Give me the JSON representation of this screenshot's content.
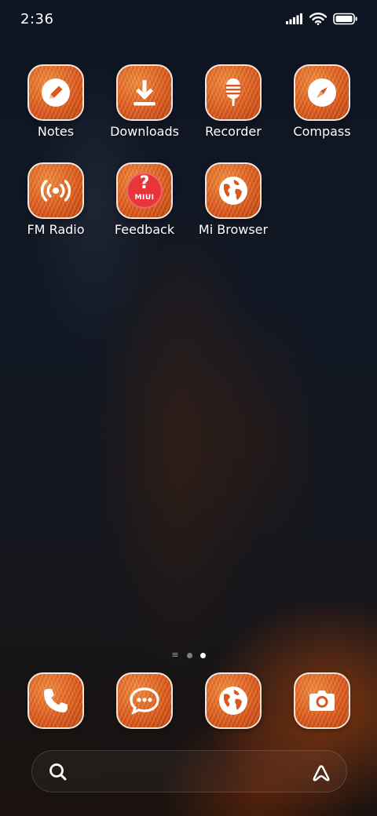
{
  "status_bar": {
    "time": "2:36",
    "icons": [
      "signal-icon",
      "wifi-icon",
      "battery-icon"
    ]
  },
  "home_apps": [
    {
      "label": "Notes",
      "icon": "pencil-icon"
    },
    {
      "label": "Downloads",
      "icon": "download-icon"
    },
    {
      "label": "Recorder",
      "icon": "microphone-icon"
    },
    {
      "label": "Compass",
      "icon": "compass-icon"
    },
    {
      "label": "FM Radio",
      "icon": "radio-icon"
    },
    {
      "label": "Feedback",
      "icon": "feedback-icon",
      "badge_text": "MIUI",
      "symbol": "?"
    },
    {
      "label": "Mi Browser",
      "icon": "globe-icon"
    }
  ],
  "page_indicator": {
    "pages": 2,
    "active_page": 2,
    "has_menu": true
  },
  "dock": [
    {
      "icon": "phone-icon"
    },
    {
      "icon": "message-icon"
    },
    {
      "icon": "globe-icon"
    },
    {
      "icon": "camera-icon"
    }
  ],
  "search_bar": {
    "left_icon": "search-icon",
    "right_icon": "assistant-icon"
  },
  "colors": {
    "tile_orange": "#d9581c",
    "tile_border": "#f4e6dc",
    "feedback_red": "#e8353a"
  }
}
